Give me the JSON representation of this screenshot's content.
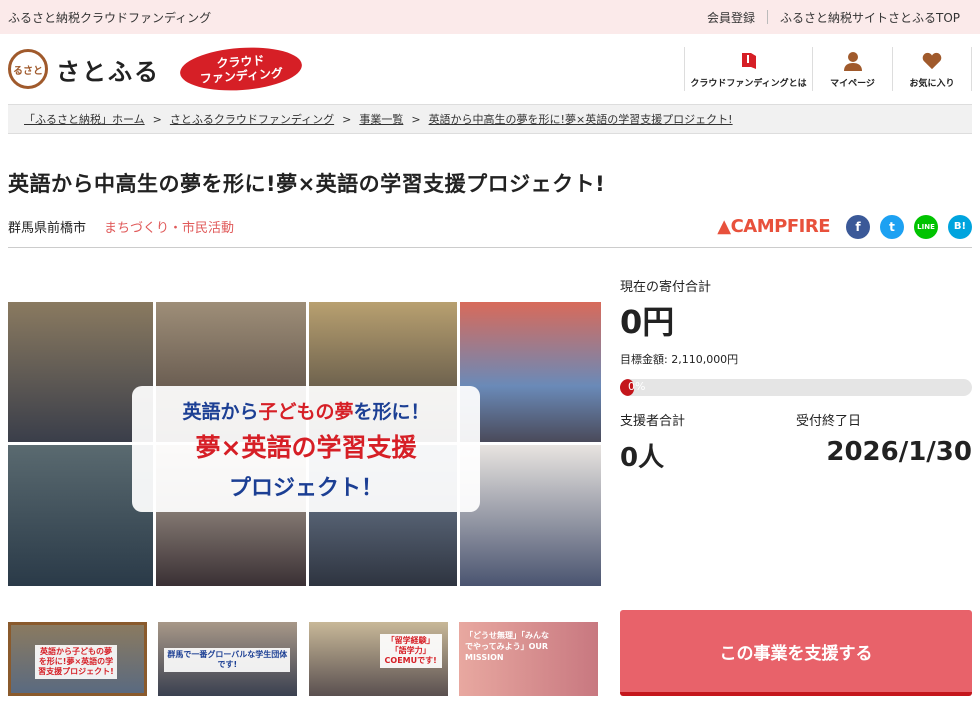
{
  "topbar": {
    "site_label": "ふるさと納税クラウドファンディング",
    "links": [
      "会員登録",
      "ふるさと納税サイトさとふるTOP"
    ]
  },
  "header": {
    "logo_mark": "るさと",
    "logo_text": "さとふる",
    "badge_line1": "クラウド",
    "badge_line2": "ファンディング",
    "nav": [
      {
        "label": "クラウドファンディングとは",
        "icon": "book-icon"
      },
      {
        "label": "マイページ",
        "icon": "user-icon"
      },
      {
        "label": "お気に入り",
        "icon": "heart-icon"
      }
    ]
  },
  "breadcrumb": [
    "「ふるさと納税」ホーム",
    "さとふるクラウドファンディング",
    "事業一覧",
    "英語から中高生の夢を形に!夢×英語の学習支援プロジェクト!"
  ],
  "project": {
    "title": "英語から中高生の夢を形に!夢×英語の学習支援プロジェクト!",
    "location": "群馬県前橋市",
    "category": "まちづくり・市民活動",
    "partner": "CAMPFIRE"
  },
  "sns": [
    {
      "label": "f",
      "icon": "facebook-icon",
      "color": "#3b5998"
    },
    {
      "label": "t",
      "icon": "twitter-icon",
      "color": "#1da1f2"
    },
    {
      "label": "LINE",
      "icon": "line-icon",
      "color": "#00c300"
    },
    {
      "label": "B!",
      "icon": "hatena-icon",
      "color": "#00a4de"
    }
  ],
  "hero": {
    "line1a": "英語から",
    "line1b": "子どもの夢",
    "line1c": "を形に！",
    "line2": "夢×英語の学習支援",
    "line3": "プロジェクト！"
  },
  "thumbs": [
    {
      "text": "英語から子どもの夢を形に!夢×英語の学習支援プロジェクト!"
    },
    {
      "text": "群馬で一番グローバルな学生団体です!"
    },
    {
      "text": "「留学経験」「語学力」COEMUです!"
    },
    {
      "text": "「どうせ無理」「みんなでやってみよう」OUR MISSION"
    }
  ],
  "stats": {
    "total_label": "現在の寄付合計",
    "total_value": "0円",
    "goal": "目標金額: 2,110,000円",
    "progress_label": "0%",
    "progress": 0,
    "supporters_label": "支援者合計",
    "supporters_value": "0人",
    "deadline_label": "受付終了日",
    "deadline_value": "2026/1/30"
  },
  "support_button": "この事業を支援する",
  "colors": {
    "accent": "#e8626a",
    "brand_red": "#d61f26",
    "brown": "#a05a2c"
  }
}
